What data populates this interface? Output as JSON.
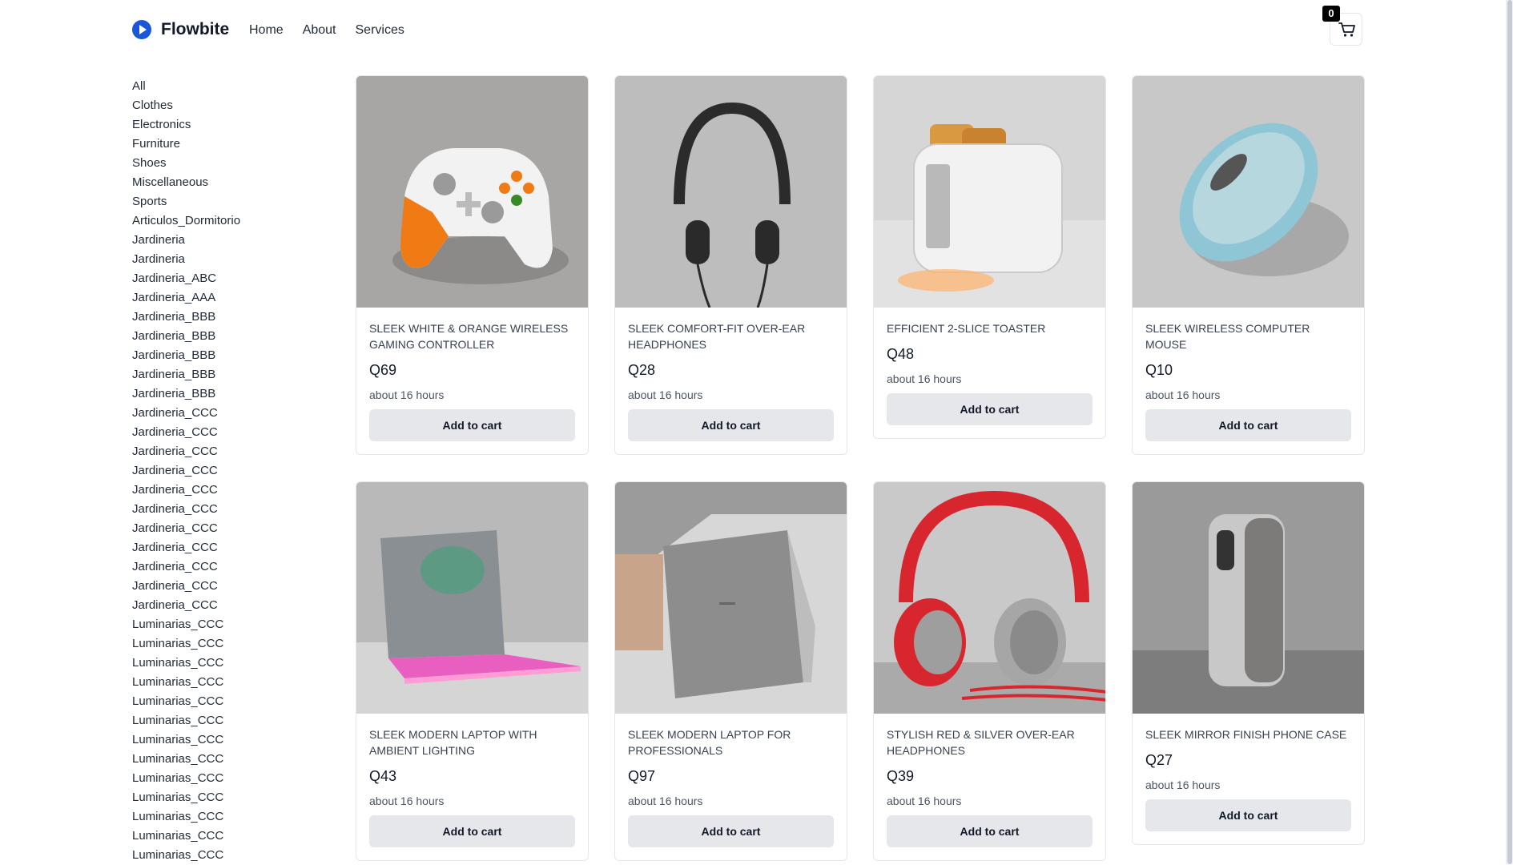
{
  "nav": {
    "brand": "Flowbite",
    "links": [
      "Home",
      "About",
      "Services"
    ],
    "cart_count": "0"
  },
  "categories": [
    "All",
    "Clothes",
    "Electronics",
    "Furniture",
    "Shoes",
    "Miscellaneous",
    "Sports",
    "Articulos_Dormitorio",
    "Jardineria",
    "Jardineria",
    "Jardineria_ABC",
    "Jardineria_AAA",
    "Jardineria_BBB",
    "Jardineria_BBB",
    "Jardineria_BBB",
    "Jardineria_BBB",
    "Jardineria_BBB",
    "Jardineria_CCC",
    "Jardineria_CCC",
    "Jardineria_CCC",
    "Jardineria_CCC",
    "Jardineria_CCC",
    "Jardineria_CCC",
    "Jardineria_CCC",
    "Jardineria_CCC",
    "Jardineria_CCC",
    "Jardineria_CCC",
    "Jardineria_CCC",
    "Luminarias_CCC",
    "Luminarias_CCC",
    "Luminarias_CCC",
    "Luminarias_CCC",
    "Luminarias_CCC",
    "Luminarias_CCC",
    "Luminarias_CCC",
    "Luminarias_CCC",
    "Luminarias_CCC",
    "Luminarias_CCC",
    "Luminarias_CCC",
    "Luminarias_CCC",
    "Luminarias_CCC"
  ],
  "products": [
    {
      "title": "Sleek White & Orange Wireless Gaming Controller",
      "price": "Q69",
      "time": "about 16 hours",
      "button": "Add to cart",
      "image": "gamepad"
    },
    {
      "title": "Sleek Comfort-Fit Over-Ear Headphones",
      "price": "Q28",
      "time": "about 16 hours",
      "button": "Add to cart",
      "image": "headphones-black"
    },
    {
      "title": "Efficient 2-Slice Toaster",
      "price": "Q48",
      "time": "about 16 hours",
      "button": "Add to cart",
      "image": "toaster"
    },
    {
      "title": "Sleek Wireless Computer Mouse",
      "price": "Q10",
      "time": "about 16 hours",
      "button": "Add to cart",
      "image": "mouse"
    },
    {
      "title": "Sleek Modern Laptop with Ambient Lighting",
      "price": "Q43",
      "time": "about 16 hours",
      "button": "Add to cart",
      "image": "laptop-glow"
    },
    {
      "title": "Sleek Modern Laptop for Professionals",
      "price": "Q97",
      "time": "about 16 hours",
      "button": "Add to cart",
      "image": "laptop-silver"
    },
    {
      "title": "Stylish Red & Silver Over-Ear Headphones",
      "price": "Q39",
      "time": "about 16 hours",
      "button": "Add to cart",
      "image": "headphones-red"
    },
    {
      "title": "Sleek Mirror Finish Phone Case",
      "price": "Q27",
      "time": "about 16 hours",
      "button": "Add to cart",
      "image": "phone-case"
    }
  ],
  "colors": {
    "accent": "#1a56db",
    "button_bg": "#e5e7eb",
    "border": "#e5e7eb"
  }
}
